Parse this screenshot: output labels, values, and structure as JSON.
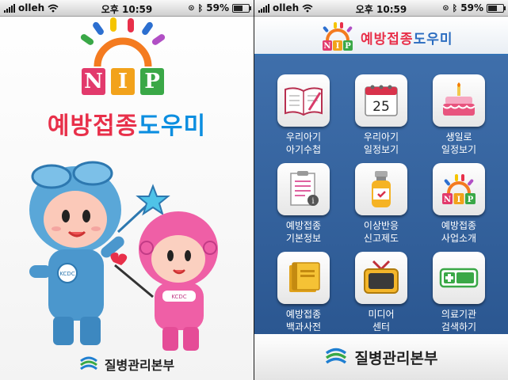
{
  "status_bar": {
    "carrier": "olleh",
    "time": "오후 10:59",
    "battery_percent": "59%",
    "battery_level": 0.59
  },
  "splash": {
    "logo_letters": [
      "N",
      "I",
      "P"
    ],
    "title_part1": "예방접종",
    "title_part2": "도우미",
    "badge_text_1": "KCDC",
    "badge_text_2": "KCDC",
    "footer_org": "질병관리본부"
  },
  "menu": {
    "header_title_part1": "예방접종",
    "header_title_part2": "도우미",
    "calendar_day": "25",
    "nip_letters": [
      "N",
      "I",
      "P"
    ],
    "items": [
      {
        "line1": "우리아기",
        "line2": "아기수첩",
        "icon": "notebook-icon"
      },
      {
        "line1": "우리아기",
        "line2": "일정보기",
        "icon": "calendar-icon"
      },
      {
        "line1": "생일로",
        "line2": "일정보기",
        "icon": "birthday-cake-icon"
      },
      {
        "line1": "예방접종",
        "line2": "기본정보",
        "icon": "document-info-icon"
      },
      {
        "line1": "이상반응",
        "line2": "신고제도",
        "icon": "medicine-vial-icon"
      },
      {
        "line1": "예방접종",
        "line2": "사업소개",
        "icon": "nip-logo-icon"
      },
      {
        "line1": "예방접종",
        "line2": "백과사전",
        "icon": "book-icon"
      },
      {
        "line1": "미디어",
        "line2": "센터",
        "icon": "television-icon"
      },
      {
        "line1": "의료기관",
        "line2": "검색하기",
        "icon": "hospital-search-icon"
      }
    ],
    "footer_org": "질병관리본부"
  },
  "colors": {
    "title_red": "#e8304a",
    "title_blue": "#0c8ee0",
    "menu_bg": "#3f6fab",
    "nip_n": "#e23a6c",
    "nip_i": "#f2a21b",
    "nip_p": "#3aa847"
  }
}
